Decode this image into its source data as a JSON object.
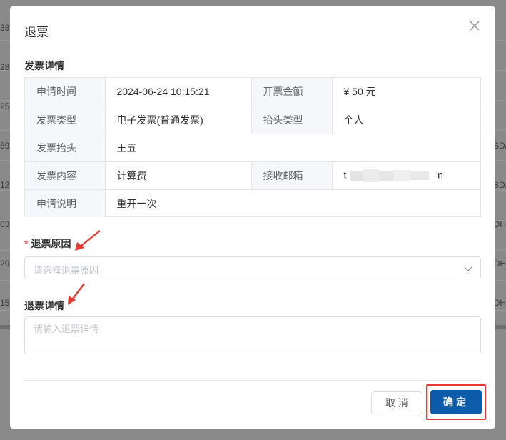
{
  "background": {
    "left_fragments": [
      "38",
      "28",
      "25",
      "59",
      "12",
      "03",
      "29",
      "15"
    ],
    "right_fragments": [
      "SDA",
      "SDA",
      "DH",
      "DH",
      "DH"
    ]
  },
  "modal": {
    "title": "退票",
    "close_icon": "close-icon"
  },
  "invoice_details": {
    "title": "发票详情",
    "rows": [
      {
        "label1": "申请时间",
        "value1": "2024-06-24 10:15:21",
        "label2": "开票金额",
        "value2": "¥ 50 元"
      },
      {
        "label1": "发票类型",
        "value1": "电子发票(普通发票)",
        "label2": "抬头类型",
        "value2": "个人"
      },
      {
        "label1": "发票抬头",
        "value1": "王五"
      },
      {
        "label1": "发票内容",
        "value1": "计算费",
        "label2": "接收邮箱",
        "value2_start": "t",
        "value2_end": "n"
      },
      {
        "label1": "申请说明",
        "value1": "重开一次"
      }
    ]
  },
  "refund_reason": {
    "label": "退票原因",
    "required_mark": "*",
    "placeholder": "请选择退票原因"
  },
  "refund_details": {
    "label": "退票详情",
    "placeholder": "请输入退票详情"
  },
  "footer": {
    "cancel_label": "取 消",
    "confirm_label": "确定"
  },
  "colors": {
    "primary": "#0d5bab",
    "required": "#f56c6c",
    "annotation": "#e53935"
  }
}
